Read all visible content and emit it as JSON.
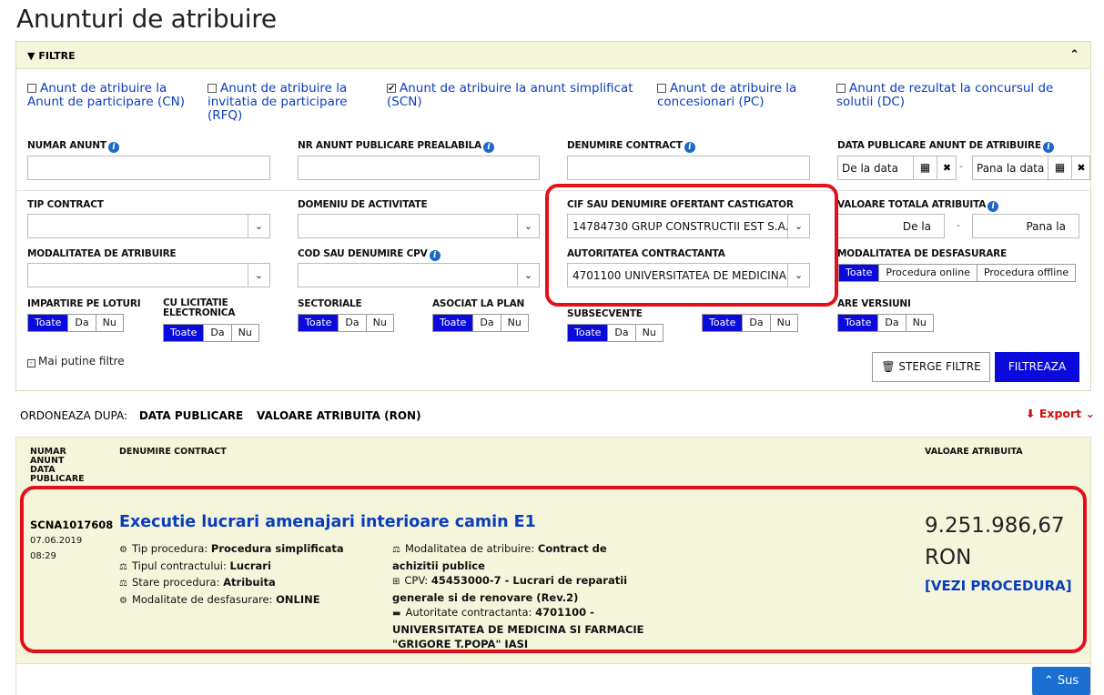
{
  "page": {
    "title": "Anunturi de atribuire"
  },
  "filters": {
    "header": "FILTRE",
    "checkboxes": [
      {
        "label": "Anunt de atribuire la Anunt de participare (CN)",
        "checked": false
      },
      {
        "label": "Anunt de atribuire la invitatia de participare (RFQ)",
        "checked": false
      },
      {
        "label": "Anunt de atribuire la anunt simplificat (SCN)",
        "checked": true
      },
      {
        "label": "Anunt de atribuire la concesionari (PC)",
        "checked": false
      },
      {
        "label": "Anunt de rezultat la concursul de solutii (DC)",
        "checked": false
      }
    ],
    "numar_anunt": "NUMAR ANUNT",
    "nr_anunt_prealabila": "NR ANUNT PUBLICARE PREALABILA",
    "denumire_contract": "DENUMIRE CONTRACT",
    "data_publicare": "DATA PUBLICARE ANUNT DE ATRIBUIRE",
    "de_la_data": "De la data",
    "pana_la_data": "Pana la data",
    "tip_contract": "TIP CONTRACT",
    "domeniu": "DOMENIU DE ACTIVITATE",
    "cif_label": "CIF SAU DENUMIRE OFERTANT CASTIGATOR",
    "cif_value": "14784730 GRUP CONSTRUCTII EST S.A.",
    "valoare_totala": "VALOARE TOTALA ATRIBUITA",
    "de_la": "De la",
    "pana_la": "Pana la",
    "modalitatea_atribuire": "MODALITATEA DE ATRIBUIRE",
    "cod_cpv": "COD SAU DENUMIRE CPV",
    "autoritate_label": "AUTORITATEA CONTRACTANTA",
    "autoritate_value": "4701100 UNIVERSITATEA DE MEDICINA",
    "modalitatea_desfasurare": "MODALITATEA DE DESFASURARE",
    "desf_opts": [
      "Toate",
      "Procedura online",
      "Procedura offline"
    ],
    "impartire": "IMPARTIRE PE LOTURI",
    "cu_licitatie": "CU LICITATIE ELECTRONICA",
    "sectoriale": "SECTORIALE",
    "asociat": "ASOCIAT LA PLAN",
    "subsecvente": "SUBSECVENTE",
    "are_versiuni": "ARE VERSIUNI",
    "tog": [
      "Toate",
      "Da",
      "Nu"
    ],
    "mai_putine": "Mai putine filtre",
    "sterge": "STERGE FILTRE",
    "filtreaza": "FILTREAZA"
  },
  "sort": {
    "label": "ORDONEAZA DUPA:",
    "opt1": "DATA PUBLICARE",
    "opt2": "VALOARE ATRIBUITA (RON)",
    "export": "Export"
  },
  "results": {
    "col1": [
      "NUMAR",
      "ANUNT",
      "DATA",
      "PUBLICARE"
    ],
    "col2": "DENUMIRE CONTRACT",
    "col3": "VALOARE ATRIBUITA",
    "item": {
      "id": "SCNA1017608",
      "date": "07.06.2019",
      "time": "08:29",
      "title": "Executie lucrari amenajari interioare camin E1",
      "tip_procedura_k": "Tip procedura:",
      "tip_procedura_v": "Procedura simplificata",
      "tipul_contract_k": "Tipul contractului:",
      "tipul_contract_v": "Lucrari",
      "stare_k": "Stare procedura:",
      "stare_v": "Atribuita",
      "mod_desf_k": "Modalitate de desfasurare:",
      "mod_desf_v": "ONLINE",
      "mod_atr_k": "Modalitatea de atribuire:",
      "mod_atr_v1": "Contract de",
      "mod_atr_v2": "achizitii publice",
      "cpv_k": "CPV:",
      "cpv_v1": "45453000-7 - Lucrari de reparatii",
      "cpv_v2": "generale si de renovare (Rev.2)",
      "aut_k": "Autoritate contractanta:",
      "aut_v1": "4701100 -",
      "aut_v2": "UNIVERSITATEA DE MEDICINA SI FARMACIE",
      "aut_v3": "\"GRIGORE T.POPA\" IASI",
      "value": "9.251.986,67",
      "currency": "RON",
      "link": "[VEZI PROCEDURA]"
    }
  },
  "sus": "Sus",
  "colors": {
    "accent": "#0a0adc",
    "link": "#0a3dbd",
    "highlight": "#e2101b",
    "panel": "#f5f5dc"
  }
}
